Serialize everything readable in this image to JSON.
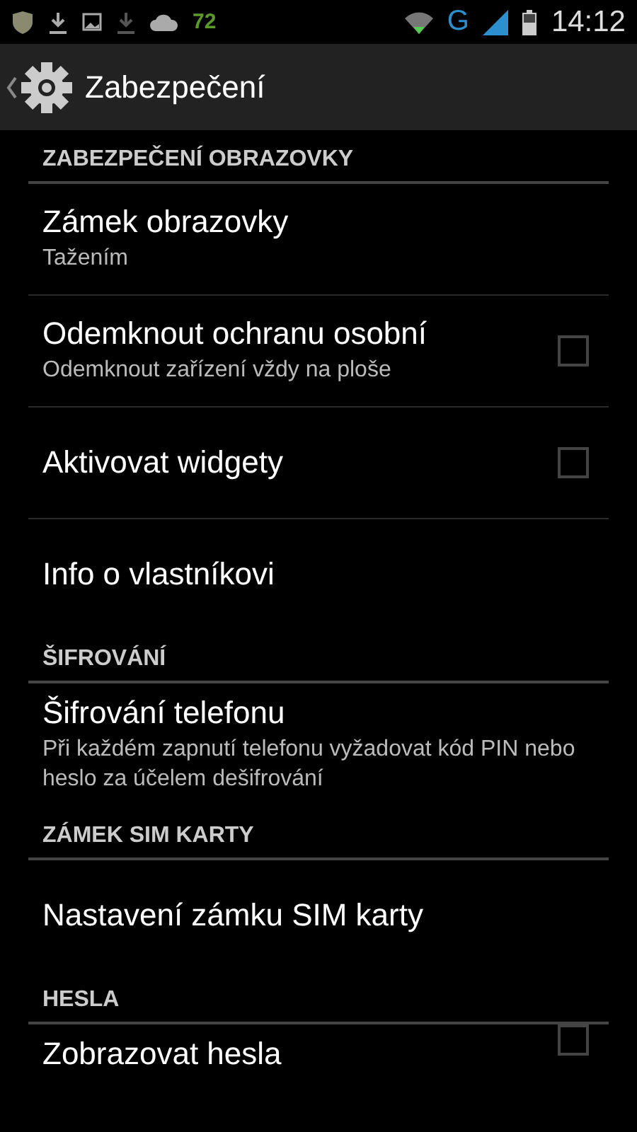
{
  "status_bar": {
    "battery_percent": "72",
    "network": "G",
    "time": "14:12"
  },
  "action_bar": {
    "title": "Zabezpečení"
  },
  "sections": [
    {
      "header": "ZABEZPEČENÍ OBRAZOVKY",
      "items": [
        {
          "kind": "plain",
          "title": "Zámek obrazovky",
          "summary": "Tažením"
        },
        {
          "kind": "checkbox",
          "title": "Odemknout ochranu osobní",
          "summary": "Odemknout zařízení vždy na ploše",
          "checked": false
        },
        {
          "kind": "checkbox",
          "title": "Aktivovat widgety",
          "checked": false
        },
        {
          "kind": "plain",
          "title": "Info o vlastníkovi"
        }
      ]
    },
    {
      "header": "ŠIFROVÁNÍ",
      "items": [
        {
          "kind": "plain",
          "title": "Šifrování telefonu",
          "summary": "Při každém zapnutí telefonu vyžadovat kód PIN nebo heslo za účelem dešifrování"
        }
      ]
    },
    {
      "header": "ZÁMEK SIM KARTY",
      "items": [
        {
          "kind": "plain",
          "title": "Nastavení zámku SIM karty"
        }
      ]
    },
    {
      "header": "HESLA",
      "items": [
        {
          "kind": "checkbox",
          "title": "Zobrazovat hesla",
          "checked": false
        }
      ]
    }
  ]
}
